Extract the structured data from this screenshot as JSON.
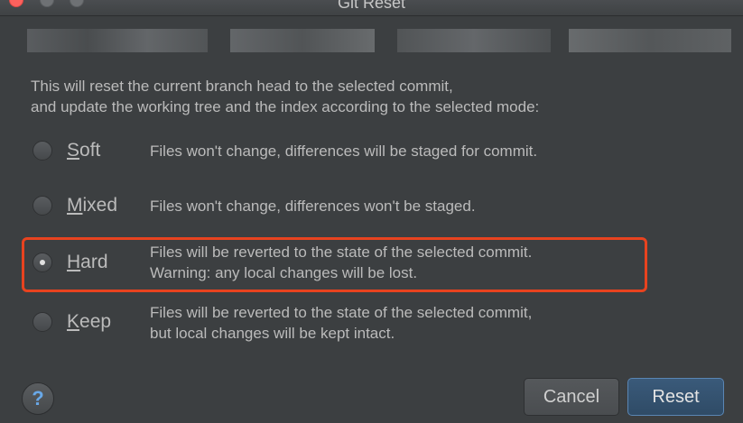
{
  "window": {
    "title": "Git Reset"
  },
  "description": {
    "line1": "This will reset the current branch head to the selected commit,",
    "line2": "and update the working tree and the index according to the selected mode:"
  },
  "options": [
    {
      "mnemonic": "S",
      "rest": "oft",
      "line1": "Files won't change, differences will be staged for commit.",
      "line2": "",
      "selected": false
    },
    {
      "mnemonic": "M",
      "rest": "ixed",
      "line1": "Files won't change, differences won't be staged.",
      "line2": "",
      "selected": false
    },
    {
      "mnemonic": "H",
      "rest": "ard",
      "line1": "Files will be reverted to the state of the selected commit.",
      "line2": "Warning: any local changes will be lost.",
      "selected": true
    },
    {
      "mnemonic": "K",
      "rest": "eep",
      "line1": "Files will be reverted to the state of the selected commit,",
      "line2": "but local changes will be kept intact.",
      "selected": false
    }
  ],
  "buttons": {
    "help": "?",
    "cancel": "Cancel",
    "reset": "Reset"
  },
  "colors": {
    "highlight": "#e8431f",
    "background": "#3c3f41"
  }
}
